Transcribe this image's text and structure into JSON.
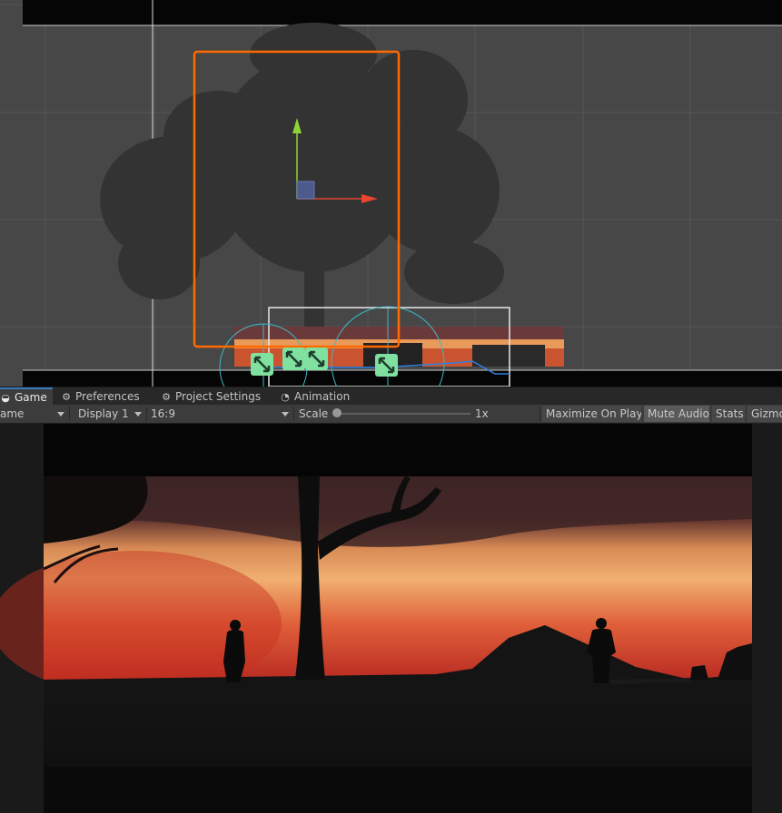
{
  "tabs": [
    {
      "label": "Game",
      "icon": "game-icon",
      "active": true
    },
    {
      "label": "Preferences",
      "icon": "gear-icon",
      "active": false
    },
    {
      "label": "Project Settings",
      "icon": "gear-icon",
      "active": false
    },
    {
      "label": "Animation",
      "icon": "clock-icon",
      "active": false
    }
  ],
  "toolbar": {
    "view_dropdown": "ame",
    "display_dropdown": "Display 1",
    "aspect_dropdown": "16:9",
    "scale_label": "Scale",
    "scale_value": "1x",
    "scale_fraction": 0.0,
    "maximize_on_play": "Maximize On Play",
    "mute_audio": "Mute Audio",
    "mute_audio_active": true,
    "stats": "Stats",
    "gizmos": "Gizmo"
  },
  "colors": {
    "scene_bg": "#474747",
    "selection_orange": "#ff6a00",
    "gizmo_green": "#7fe0a0",
    "collider_cyan": "#3fb7c9",
    "axis_x": "#e8452c",
    "axis_y": "#8ed23a",
    "tab_active_accent": "#3a79bb",
    "sky_glow": "#e6a060"
  }
}
